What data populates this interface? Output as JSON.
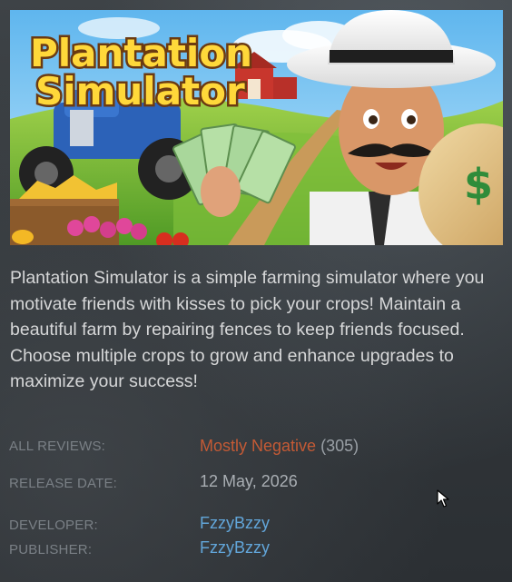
{
  "capsule": {
    "logo_line1": "Plantation",
    "logo_line2": "Simulator",
    "money_symbol": "$"
  },
  "description": "Plantation Simulator is a simple farming simulator where you motivate friends with kisses to pick your crops! Maintain a beautiful farm by repairing fences to keep friends focused. Choose multiple crops to grow and enhance upgrades to maximize your success!",
  "reviews": {
    "label": "ALL REVIEWS:",
    "summary": "Mostly Negative",
    "count": "(305)"
  },
  "release": {
    "label": "RELEASE DATE:",
    "date": "12 May, 2026"
  },
  "developer": {
    "label": "DEVELOPER:",
    "name": "FzzyBzzy"
  },
  "publisher": {
    "label": "PUBLISHER:",
    "name": "FzzyBzzy"
  },
  "colors": {
    "negative_review": "#c45a35",
    "link": "#62a6da",
    "label": "#7a8086",
    "text": "#d6d7d8"
  }
}
